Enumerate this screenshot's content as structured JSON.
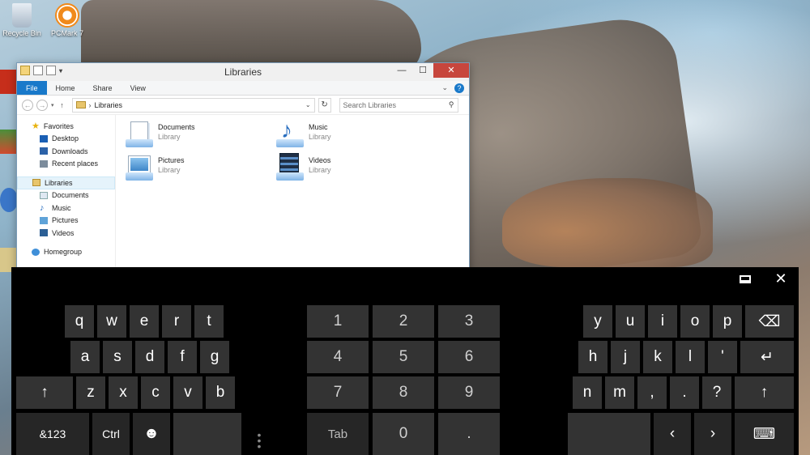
{
  "desktop": {
    "icons": [
      {
        "label": "Recycle Bin",
        "icon": "recycle-bin-icon"
      },
      {
        "label": "PCMark 7",
        "icon": "pcmark-icon"
      }
    ]
  },
  "explorer": {
    "title": "Libraries",
    "window_buttons": {
      "minimize": "—",
      "maximize": "☐",
      "close": "✕"
    },
    "ribbon": {
      "tabs": [
        "File",
        "Home",
        "Share",
        "View"
      ]
    },
    "address": {
      "path": "Libraries"
    },
    "search": {
      "placeholder": "Search Libraries"
    },
    "nav": {
      "favorites": "Favorites",
      "favorites_items": [
        "Desktop",
        "Downloads",
        "Recent places"
      ],
      "libraries": "Libraries",
      "libraries_items": [
        "Documents",
        "Music",
        "Pictures",
        "Videos"
      ],
      "homegroup": "Homegroup"
    },
    "libraries": [
      {
        "name": "Documents",
        "type": "Library",
        "icon": "documents-library-icon"
      },
      {
        "name": "Music",
        "type": "Library",
        "icon": "music-library-icon"
      },
      {
        "name": "Pictures",
        "type": "Library",
        "icon": "pictures-library-icon"
      },
      {
        "name": "Videos",
        "type": "Library",
        "icon": "videos-library-icon"
      }
    ]
  },
  "keyboard": {
    "left": {
      "row1": [
        "q",
        "w",
        "e",
        "r",
        "t"
      ],
      "row2": [
        "a",
        "s",
        "d",
        "f",
        "g"
      ],
      "row3": [
        "↑",
        "z",
        "x",
        "c",
        "v",
        "b"
      ],
      "row4": [
        "&123",
        "Ctrl",
        "☻",
        ""
      ]
    },
    "numpad": {
      "row1": [
        "1",
        "2",
        "3"
      ],
      "row2": [
        "4",
        "5",
        "6"
      ],
      "row3": [
        "7",
        "8",
        "9"
      ],
      "row4": [
        "Tab",
        "0",
        "."
      ]
    },
    "right": {
      "row1": [
        "y",
        "u",
        "i",
        "o",
        "p",
        "⌫"
      ],
      "row2": [
        "h",
        "j",
        "k",
        "l",
        "'",
        "↵"
      ],
      "row3": [
        "n",
        "m",
        ",",
        ".",
        "?",
        "↑"
      ],
      "row4": [
        "",
        "‹",
        "›",
        "⌨"
      ]
    },
    "top_buttons": {
      "close": "✕"
    }
  },
  "colors": {
    "accent": "#1979ca",
    "close_red": "#c7463d",
    "key": "#333333",
    "keyboard_bg": "#000000"
  }
}
